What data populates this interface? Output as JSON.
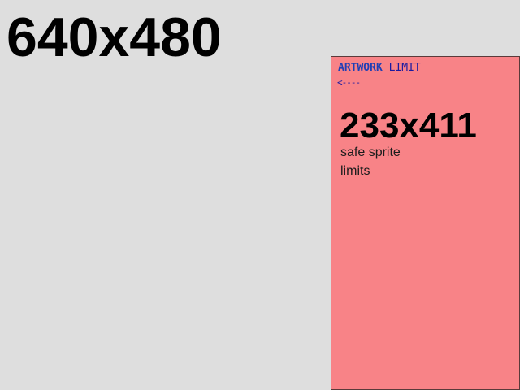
{
  "screen": {
    "size_label": "640x480"
  },
  "panel": {
    "title_word_1": "ARTWORK",
    "title_word_2": "LIMIT",
    "arrow": "<----",
    "size_label": "233x411",
    "caption_line_1": "safe sprite",
    "caption_line_2": "limits"
  },
  "colors": {
    "background": "#dedede",
    "panel_fill": "#f88387",
    "panel_title": "#1f3fb5"
  }
}
